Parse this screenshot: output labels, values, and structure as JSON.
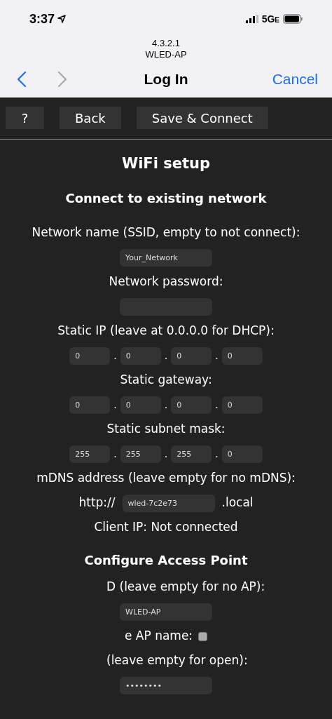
{
  "status_bar": {
    "time": "3:37",
    "network": "5G",
    "network_suffix": "E"
  },
  "browser": {
    "host": "4.3.2.1",
    "subtitle": "WLED-AP",
    "back_enabled": true,
    "forward_enabled": false,
    "title": "Log In",
    "cancel": "Cancel"
  },
  "toolbar": [
    "?",
    "Back",
    "Save & Connect"
  ],
  "page": {
    "title": "WiFi setup",
    "section": "Connect to existing network",
    "rows": [
      {
        "kind": "label",
        "text": "Network name (SSID, empty to not connect):"
      },
      {
        "kind": "field",
        "value": "Your_Network"
      },
      {
        "kind": "label",
        "text": "Network password:"
      },
      {
        "kind": "field",
        "value": ""
      },
      {
        "kind": "label",
        "text": "Static IP (leave at 0.0.0.0 for DHCP):"
      },
      {
        "kind": "ip",
        "separator": ".",
        "parts": [
          "0",
          "0",
          "0",
          "0"
        ]
      },
      {
        "kind": "label",
        "text": "Static gateway:"
      },
      {
        "kind": "ip",
        "separator": ".",
        "parts": [
          "0",
          "0",
          "0",
          "0"
        ]
      },
      {
        "kind": "label",
        "text": "Static subnet mask:"
      },
      {
        "kind": "ip",
        "separator": ".",
        "parts": [
          "255",
          "255",
          "255",
          "0"
        ]
      },
      {
        "kind": "label",
        "text": "mDNS address (leave empty for no mDNS):"
      },
      {
        "kind": "mdns",
        "prefix": "http://",
        "value": "wled-7c2e73",
        "suffix": ".local"
      },
      {
        "kind": "label",
        "text": "Client IP: Not connected"
      },
      {
        "kind": "heading",
        "text": "Configure Access Point"
      },
      {
        "kind": "partial_label",
        "text": "D (leave empty for no AP):"
      },
      {
        "kind": "partial_field",
        "value": "WLED-AP"
      },
      {
        "kind": "partial_check",
        "text": "e AP name:",
        "checked": false
      },
      {
        "kind": "partial_label",
        "text": "(leave empty for open):"
      },
      {
        "kind": "partial_field",
        "value": "••••••••"
      }
    ]
  }
}
